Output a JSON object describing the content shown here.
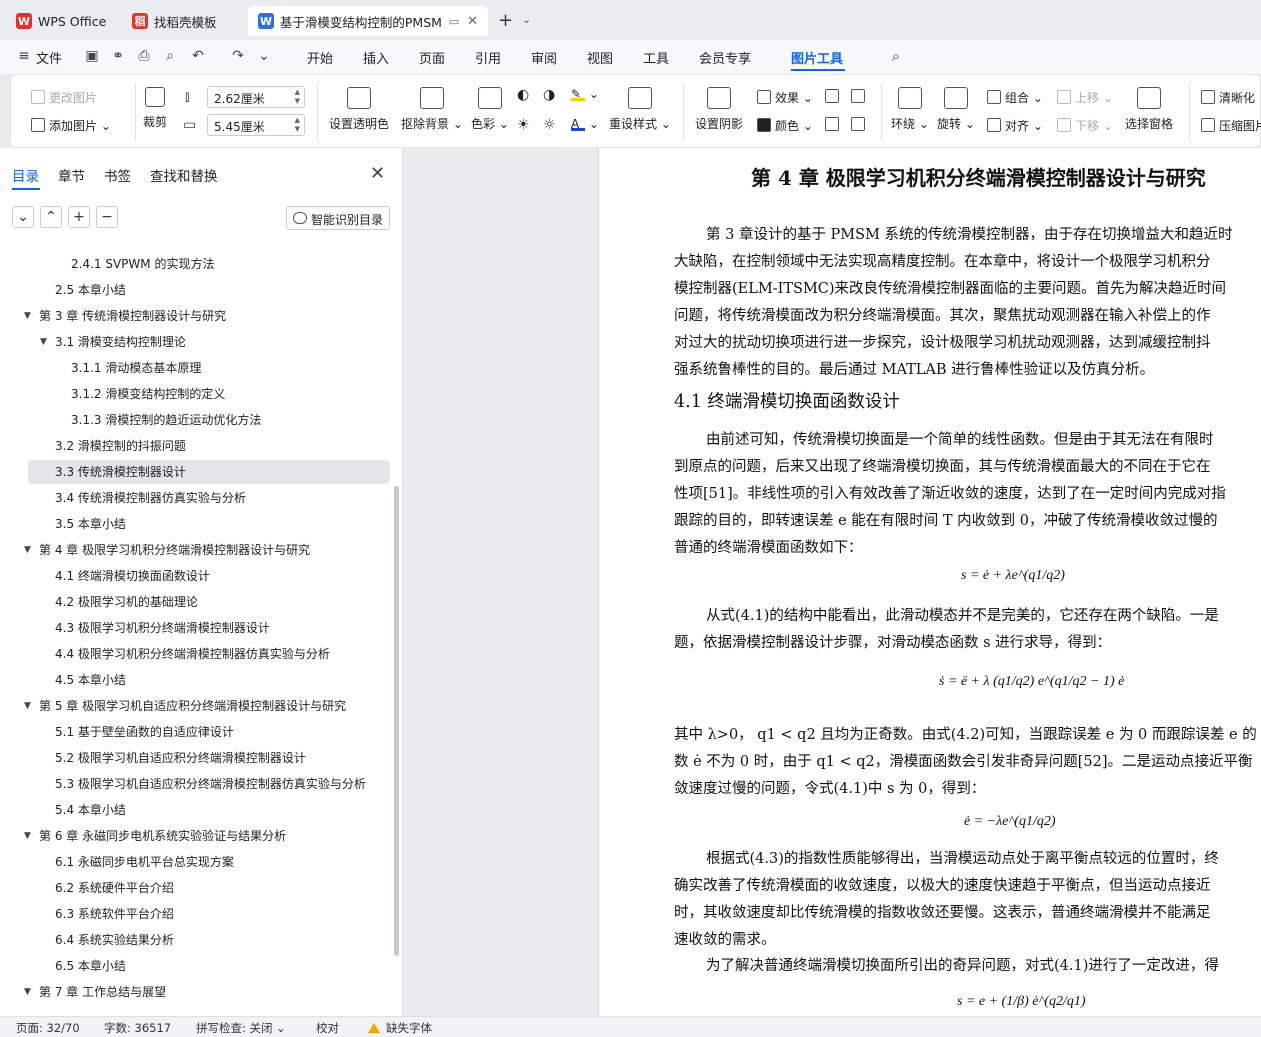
{
  "tabs": [
    {
      "label": "WPS Office",
      "logo": "W",
      "color": "#e3322b"
    },
    {
      "label": "找稻壳模板",
      "logo": "稻",
      "color": "#e3322b"
    },
    {
      "label": "基于滑模变结构控制的PMSM",
      "logo": "W",
      "color": "#2f6de4"
    }
  ],
  "menu": {
    "file": "文件",
    "items": [
      "开始",
      "插入",
      "页面",
      "引用",
      "审阅",
      "视图",
      "工具",
      "会员专享",
      "图片工具"
    ],
    "active": "图片工具"
  },
  "ribbon": {
    "change_picture": "更改图片",
    "add_picture": "添加图片",
    "crop": "裁剪",
    "height_value": "2.62厘米",
    "width_value": "5.45厘米",
    "set_transparent": "设置透明色",
    "remove_bg": "抠除背景",
    "color_mode": "色彩",
    "reset_style": "重设样式",
    "set_shadow": "设置阴影",
    "effects": "效果",
    "color": "颜色",
    "wrap": "环绕",
    "rotate": "旋转",
    "group": "组合",
    "align": "对齐",
    "move_up": "上移",
    "move_down": "下移",
    "selection_pane": "选择窗格",
    "sharpen": "清晰化",
    "compress": "压缩图片"
  },
  "nav": {
    "tabs": [
      "目录",
      "章节",
      "书签",
      "查找和替换"
    ],
    "smart_toc": "智能识别目录",
    "toc": [
      {
        "level": 3,
        "text": "2.4.1 SVPWM 的实现方法"
      },
      {
        "level": 2,
        "text": "2.5  本章小结"
      },
      {
        "level": 1,
        "text": "第 3 章  传统滑模控制器设计与研究",
        "expanded": true
      },
      {
        "level": 2,
        "text": "3.1  滑模变结构控制理论",
        "expanded": true
      },
      {
        "level": 3,
        "text": "3.1.1  滑动模态基本原理"
      },
      {
        "level": 3,
        "text": "3.1.2  滑模变结构控制的定义"
      },
      {
        "level": 3,
        "text": "3.1.3  滑模控制的趋近运动优化方法"
      },
      {
        "level": 2,
        "text": "3.2  滑模控制的抖振问题"
      },
      {
        "level": 2,
        "text": "3.3  传统滑模控制器设计",
        "selected": true
      },
      {
        "level": 2,
        "text": "3.4  传统滑模控制器仿真实验与分析"
      },
      {
        "level": 2,
        "text": "3.5  本章小结"
      },
      {
        "level": 1,
        "text": "第 4 章  极限学习机积分终端滑模控制器设计与研究",
        "expanded": true
      },
      {
        "level": 2,
        "text": "4.1  终端滑模切换面函数设计"
      },
      {
        "level": 2,
        "text": "4.2  极限学习机的基础理论"
      },
      {
        "level": 2,
        "text": "4.3  极限学习机积分终端滑模控制器设计"
      },
      {
        "level": 2,
        "text": "4.4  极限学习机积分终端滑模控制器仿真实验与分析"
      },
      {
        "level": 2,
        "text": "4.5  本章小结"
      },
      {
        "level": 1,
        "text": "第 5 章  极限学习机自适应积分终端滑模控制器设计与研究",
        "expanded": true
      },
      {
        "level": 2,
        "text": "5.1  基于壁垒函数的自适应律设计"
      },
      {
        "level": 2,
        "text": "5.2  极限学习机自适应积分终端滑模控制器设计"
      },
      {
        "level": 2,
        "text": "5.3  极限学习机自适应积分终端滑模控制器仿真实验与分析"
      },
      {
        "level": 2,
        "text": "5.4  本章小结"
      },
      {
        "level": 1,
        "text": "第 6 章  永磁同步电机系统实验验证与结果分析",
        "expanded": true
      },
      {
        "level": 2,
        "text": "6.1  永磁同步电机平台总实现方案"
      },
      {
        "level": 2,
        "text": "6.2  系统硬件平台介绍"
      },
      {
        "level": 2,
        "text": "6.3  系统软件平台介绍"
      },
      {
        "level": 2,
        "text": "6.4  系统实验结果分析"
      },
      {
        "level": 2,
        "text": "6.5  本章小结"
      },
      {
        "level": 1,
        "text": "第 7 章  工作总结与展望",
        "expanded": true
      }
    ]
  },
  "doc": {
    "chapter_title": "第 4 章  极限学习机积分终端滑模控制器设计与研究",
    "intro_lines": [
      "第 3 章设计的基于 PMSM 系统的传统滑模控制器，由于存在切换增益大和趋近时",
      "大缺陷，在控制领域中无法实现高精度控制。在本章中，将设计一个极限学习机积分",
      "模控制器(ELM-ITSMC)来改良传统滑模控制器面临的主要问题。首先为解决趋近时间",
      "问题，将传统滑模面改为积分终端滑模面。其次，聚焦扰动观测器在输入补偿上的作",
      "对过大的扰动切换项进行进一步探究，设计极限学习机扰动观测器，达到减缓控制抖",
      "强系统鲁棒性的目的。最后通过 MATLAB 进行鲁棒性验证以及仿真分析。"
    ],
    "section_title": "4.1  终端滑模切换面函数设计",
    "para1_lines": [
      "由前述可知，传统滑模切换面是一个简单的线性函数。但是由于其无法在有限时",
      "到原点的问题，后来又出现了终端滑模切换面，其与传统滑模面最大的不同在于它在",
      "性项[51]。非线性项的引入有效改善了渐近收敛的速度，达到了在一定时间内完成对指",
      "跟踪的目的，即转速误差 e 能在有限时间 T 内收敛到 0，冲破了传统滑模收敛过慢的",
      "普通的终端滑模面函数如下："
    ],
    "formula1": "s = ė + λe^(q1/q2)",
    "para2_lines": [
      "从式(4.1)的结构中能看出，此滑动模态并不是完美的，它还存在两个缺陷。一是",
      "题，依据滑模控制器设计步骤，对滑动模态函数 s 进行求导，得到："
    ],
    "formula2": "ṡ = ë + λ (q1/q2) e^(q1/q2 − 1) ė",
    "para3_lines": [
      "其中 λ>0，  q1 < q2 且均为正奇数。由式(4.2)可知，当跟踪误差 e 为 0 而跟踪误差 e 的",
      "数 ė 不为 0 时，由于 q1 < q2，滑模面函数会引发非奇异问题[52]。二是运动点接近平衡",
      "敛速度过慢的问题，令式(4.1)中 s 为 0，得到："
    ],
    "formula3": "ė = −λe^(q1/q2)",
    "para4_lines": [
      "根据式(4.3)的指数性质能够得出，当滑模运动点处于离平衡点较远的位置时，终",
      "确实改善了传统滑模面的收敛速度，以极大的速度快速趋于平衡点，但当运动点接近",
      "时，其收敛速度却比传统滑模的指数收敛还要慢。这表示，普通终端滑模并不能满足",
      "速收敛的需求。"
    ],
    "para5_line": "为了解决普通终端滑模切换面所引出的奇异问题，对式(4.1)进行了一定改进，得",
    "formula4": "s = e + (1/β) ė^(q2/q1)"
  },
  "status": {
    "page": "页面: 32/70",
    "words": "字数: 36517",
    "spell": "拼写检查: 关闭",
    "proof": "校对",
    "missing_font": "缺失字体"
  }
}
